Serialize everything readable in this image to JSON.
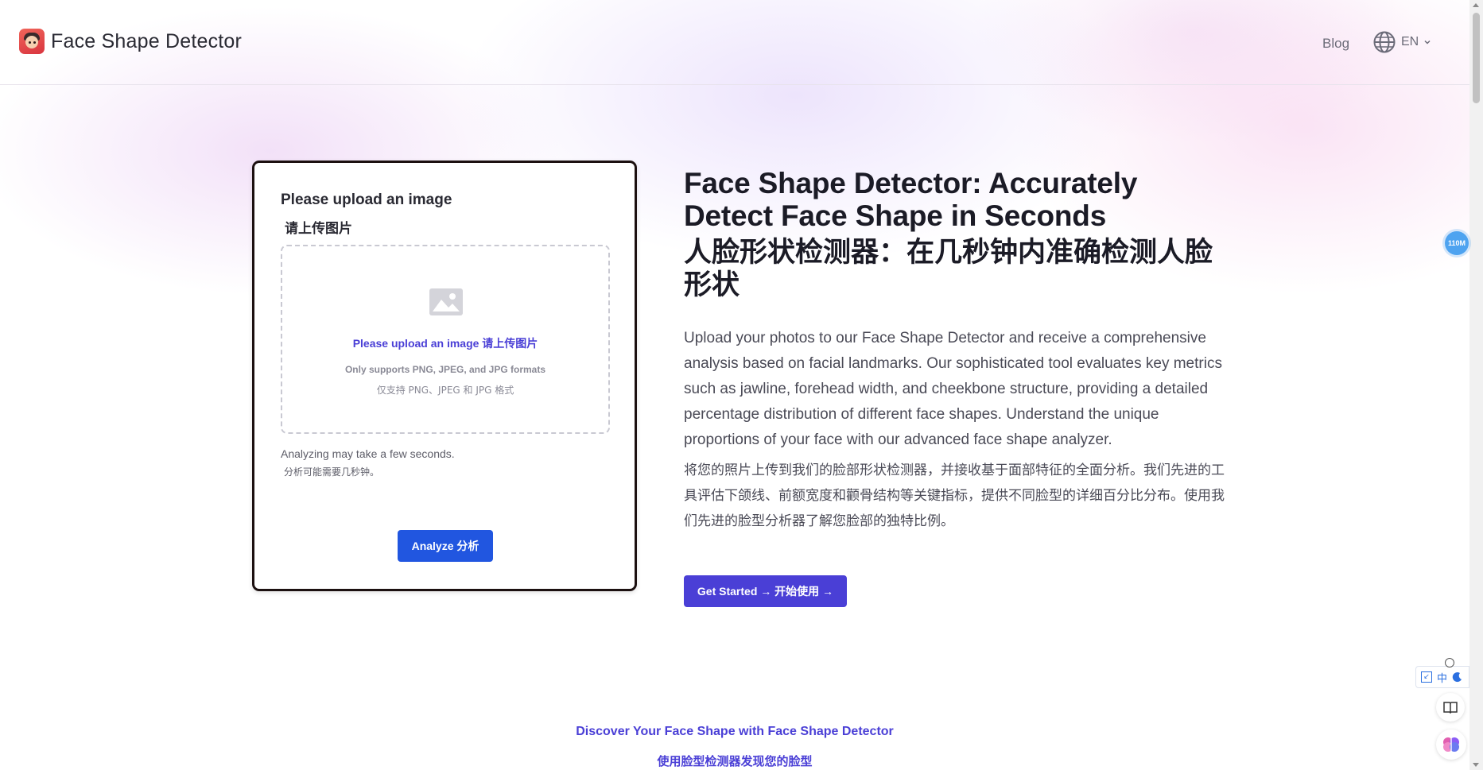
{
  "header": {
    "brand": "Face Shape Detector",
    "nav_blog": "Blog",
    "language": "EN"
  },
  "upload_card": {
    "title": "Please upload an image",
    "title_zh": "请上传图片",
    "dropzone_main": "Please upload an image 请上传图片",
    "dropzone_formats": "Only supports PNG, JPEG, and JPG formats",
    "dropzone_formats_zh": "仅支持 PNG、JPEG 和 JPG 格式",
    "note": "Analyzing may take a few seconds.",
    "note_zh": "分析可能需要几秒钟。",
    "analyze_button": "Analyze 分析"
  },
  "hero": {
    "title": "Face Shape Detector: Accurately Detect Face Shape in Seconds",
    "title_zh": "人脸形状检测器：在几秒钟内准确检测人脸形状",
    "description": "Upload your photos to our Face Shape Detector and receive a comprehensive analysis based on facial landmarks. Our sophisticated tool evaluates key metrics such as jawline, forehead width, and cheekbone structure, providing a detailed percentage distribution of different face shapes. Understand the unique proportions of your face with our advanced face shape analyzer.",
    "description_zh": "将您的照片上传到我们的脸部形状检测器，并接收基于面部特征的全面分析。我们先进的工具评估下颌线、前额宽度和颧骨结构等关键指标，提供不同脸型的详细百分比分布。使用我们先进的脸型分析器了解您脸部的独特比例。",
    "cta_button": "Get Started → 开始使用 →"
  },
  "discover": {
    "title": "Discover Your Face Shape with Face Shape Detector",
    "title_zh": "使用脸型检测器发现您的脸型"
  },
  "widgets": {
    "memory_badge": "110M",
    "translate_char": "中"
  },
  "colors": {
    "accent": "#4a3fd6",
    "analyze_button": "#2156e0",
    "text_dark": "#1b1b26",
    "text_muted": "#4a4a56"
  }
}
